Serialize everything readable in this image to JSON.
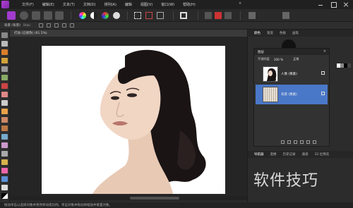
{
  "menubar": {
    "items": [
      "文件(F)",
      "编辑(E)",
      "文本(T)",
      "文档(D)",
      "排列(A)",
      "编辑",
      "视图(V)",
      "窗口(W)",
      "帮助(H)"
    ]
  },
  "context": {
    "label": "背景 (背景)",
    "value": "Bdpi"
  },
  "document": {
    "tab_label": "打动 (已修改) (61.5%)",
    "close_glyph": "×"
  },
  "panels": {
    "top_tabs": [
      "颜色",
      "渐变",
      "色板",
      "画笔"
    ],
    "lower_tabs": [
      "导航器",
      "变换",
      "历史记录",
      "通道",
      "32 位预览"
    ]
  },
  "layers": {
    "title": "图层",
    "opacity_label": "不透明度",
    "opacity_value": "100 %",
    "blend_mode": "正常",
    "items": [
      {
        "name": "人像 (像素)",
        "selected": false
      },
      {
        "name": "背景 (像素)",
        "selected": true
      }
    ]
  },
  "status": {
    "text": "拖动单击以选择对象并更改移动或比例。单击对象并拖动将缩放并重置对象。"
  },
  "watermark": "软件技巧",
  "colors": {
    "accent": "#4a78c8",
    "brand": "#b43fd6",
    "canvas": "#ffffff"
  }
}
